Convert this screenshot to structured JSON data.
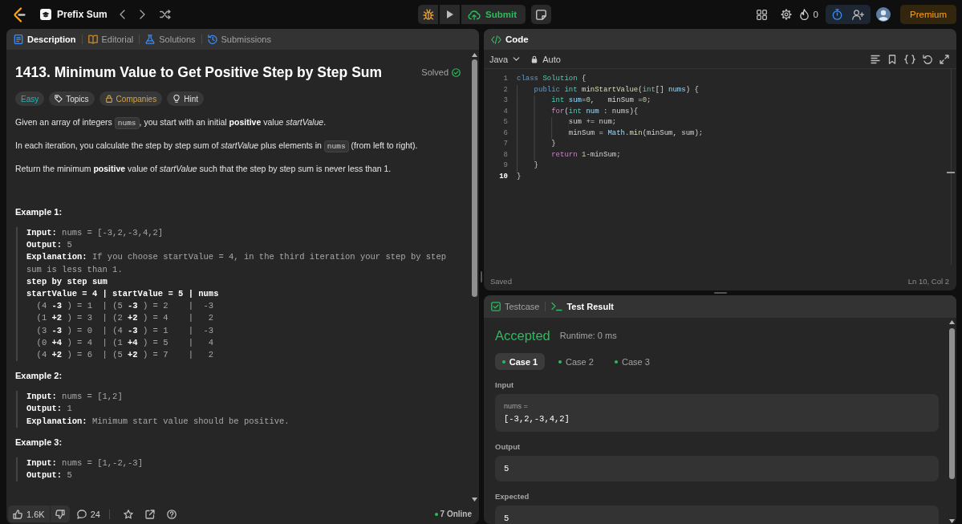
{
  "top_bar": {
    "problem_list": "Prefix Sum",
    "submit": "Submit",
    "streak": "0",
    "premium": "Premium"
  },
  "description_panel": {
    "tabs": [
      {
        "label": "Description",
        "kind": "description",
        "selected": true
      },
      {
        "label": "Editorial",
        "kind": "editorial",
        "selected": false
      },
      {
        "label": "Solutions",
        "kind": "solutions",
        "selected": false
      },
      {
        "label": "Submissions",
        "kind": "submissions",
        "selected": false
      }
    ],
    "title": "1413. Minimum Value to Get Positive Step by Step Sum",
    "status": "Solved",
    "tags": [
      {
        "label": "Easy",
        "kind": "difficulty"
      },
      {
        "label": "Topics",
        "kind": "topics"
      },
      {
        "label": "Companies",
        "kind": "companies"
      },
      {
        "label": "Hint",
        "kind": "hint"
      }
    ],
    "paragraphs": [
      {
        "segments": [
          {
            "kind": "text",
            "text": "Given an array of integers "
          },
          {
            "kind": "code",
            "text": "nums"
          },
          {
            "kind": "text",
            "text": ", you start with an initial **positive** value *startValue*."
          }
        ]
      },
      {
        "segments": [
          {
            "kind": "text",
            "text": "In each iteration, you calculate the step by step sum of *startValue* plus elements in "
          },
          {
            "kind": "code",
            "text": "nums"
          },
          {
            "kind": "text",
            "text": " (from left to right)."
          }
        ]
      },
      {
        "segments": [
          {
            "kind": "text",
            "text": "Return the minimum **positive** value of *startValue* such that the step by step sum is never less than 1."
          }
        ]
      }
    ],
    "examples": [
      {
        "heading": "Example 1:",
        "lines": [
          {
            "kind": "plain",
            "text": "**Input:** nums = [-3,2,-3,4,2]"
          },
          {
            "kind": "plain",
            "text": "**Output:** 5"
          },
          {
            "kind": "plain",
            "text": "**Explanation:** If you choose startValue = 4, in the third iteration your step by step sum is less than 1."
          },
          {
            "kind": "strong",
            "text": "step by step sum"
          },
          {
            "kind": "strong",
            "text": "startValue = 4 | startValue = 5 | nums"
          },
          {
            "kind": "plain",
            "text": "  (4 **-3** ) = 1  | (5 **-3** ) = 2    |  -3"
          },
          {
            "kind": "plain",
            "text": "  (1 **+2** ) = 3  | (2 **+2** ) = 4    |   2"
          },
          {
            "kind": "plain",
            "text": "  (3 **-3** ) = 0  | (4 **-3** ) = 1    |  -3"
          },
          {
            "kind": "plain",
            "text": "  (0 **+4** ) = 4  | (1 **+4** ) = 5    |   4"
          },
          {
            "kind": "plain",
            "text": "  (4 **+2** ) = 6  | (5 **+2** ) = 7    |   2"
          }
        ]
      },
      {
        "heading": "Example 2:",
        "lines": [
          {
            "kind": "plain",
            "text": "**Input:** nums = [1,2]"
          },
          {
            "kind": "plain",
            "text": "**Output:** 1"
          },
          {
            "kind": "plain",
            "text": "**Explanation:** Minimum start value should be positive."
          }
        ]
      },
      {
        "heading": "Example 3:",
        "lines": [
          {
            "kind": "plain",
            "text": "**Input:** nums = [1,-2,-3]"
          },
          {
            "kind": "plain",
            "text": "**Output:** 5"
          }
        ]
      }
    ],
    "footer": {
      "likes": "1.6K",
      "comments": "24",
      "online": "7 Online"
    }
  },
  "code_panel": {
    "title": "Code",
    "language": "Java",
    "mode": "Auto",
    "lines": [
      {
        "number": "1",
        "current": false,
        "tokens": [
          {
            "kind": "keyword",
            "text": "class "
          },
          {
            "kind": "type",
            "text": "Solution"
          },
          {
            "kind": "plain",
            "text": " {"
          }
        ],
        "children": [
          {
            "number": "2",
            "current": false,
            "tokens": [
              {
                "kind": "keyword",
                "text": "public "
              },
              {
                "kind": "type",
                "text": "int "
              },
              {
                "kind": "function",
                "text": "minStartValue"
              },
              {
                "kind": "plain",
                "text": "("
              },
              {
                "kind": "type",
                "text": "int"
              },
              {
                "kind": "plain",
                "text": "[] "
              },
              {
                "kind": "variable",
                "text": "nums"
              },
              {
                "kind": "plain",
                "text": ") {"
              }
            ],
            "children": [
              {
                "number": "3",
                "current": false,
                "tokens": [
                  {
                    "kind": "type",
                    "text": "int "
                  },
                  {
                    "kind": "variable",
                    "text": "sum"
                  },
                  {
                    "kind": "plain",
                    "text": "="
                  },
                  {
                    "kind": "number",
                    "text": "0"
                  },
                  {
                    "kind": "plain",
                    "text": ",   minSum ="
                  },
                  {
                    "kind": "number",
                    "text": "0"
                  },
                  {
                    "kind": "plain",
                    "text": ";"
                  }
                ]
              },
              {
                "number": "4",
                "current": false,
                "tokens": [
                  {
                    "kind": "control",
                    "text": "for"
                  },
                  {
                    "kind": "plain",
                    "text": "("
                  },
                  {
                    "kind": "type",
                    "text": "int "
                  },
                  {
                    "kind": "variable",
                    "text": "num"
                  },
                  {
                    "kind": "plain",
                    "text": " : nums){"
                  }
                ],
                "children": [
                  {
                    "number": "5",
                    "current": false,
                    "tokens": [
                      {
                        "kind": "plain",
                        "text": "sum += num;"
                      }
                    ]
                  },
                  {
                    "number": "6",
                    "current": false,
                    "tokens": [
                      {
                        "kind": "plain",
                        "text": "minSum = "
                      },
                      {
                        "kind": "variable",
                        "text": "Math"
                      },
                      {
                        "kind": "plain",
                        "text": "."
                      },
                      {
                        "kind": "function",
                        "text": "min"
                      },
                      {
                        "kind": "plain",
                        "text": "(minSum, sum);"
                      }
                    ]
                  }
                ]
              },
              {
                "number": "7",
                "current": false,
                "tokens": [
                  {
                    "kind": "plain",
                    "text": "}"
                  }
                ]
              },
              {
                "number": "8",
                "current": false,
                "tokens": [
                  {
                    "kind": "control",
                    "text": "return "
                  },
                  {
                    "kind": "number",
                    "text": "1"
                  },
                  {
                    "kind": "plain",
                    "text": "-minSum;"
                  }
                ]
              }
            ]
          },
          {
            "number": "9",
            "current": false,
            "tokens": [
              {
                "kind": "plain",
                "text": "}"
              }
            ]
          }
        ]
      },
      {
        "number": "10",
        "current": true,
        "tokens": [
          {
            "kind": "plain",
            "text": "}"
          }
        ]
      }
    ],
    "status": "Saved",
    "cursor": "Ln 10, Col 2"
  },
  "test_panel": {
    "tabs": [
      {
        "label": "Testcase",
        "kind": "testcase",
        "selected": false
      },
      {
        "label": "Test Result",
        "kind": "result",
        "selected": true
      }
    ],
    "verdict": "Accepted",
    "runtime": "Runtime: 0 ms",
    "cases": [
      {
        "label": "Case 1",
        "passed": true,
        "selected": true
      },
      {
        "label": "Case 2",
        "passed": true,
        "selected": false
      },
      {
        "label": "Case 3",
        "passed": true,
        "selected": false
      }
    ],
    "fields": [
      {
        "label": "Input",
        "name": "nums =",
        "value": "[-3,2,-3,4,2]"
      },
      {
        "label": "Output",
        "value": "5"
      },
      {
        "label": "Expected",
        "value": "5"
      }
    ]
  }
}
